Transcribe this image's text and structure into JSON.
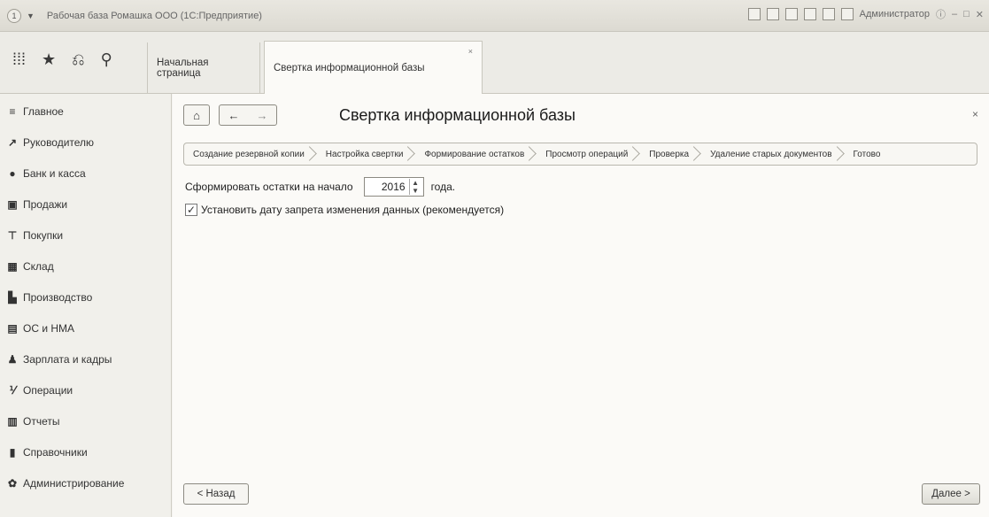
{
  "window": {
    "title": "Рабочая база Ромашка ООО  (1С:Предприятие)",
    "user": "Администратор"
  },
  "tabs": {
    "home_label": "Начальная страница",
    "active_label": "Свертка информационной базы",
    "close_glyph": "×"
  },
  "sidebar": {
    "items": [
      {
        "label": "Главное",
        "icon": "menu-icon",
        "glyph": "≡"
      },
      {
        "label": "Руководителю",
        "icon": "chart-line-icon",
        "glyph": "↗"
      },
      {
        "label": "Банк и касса",
        "icon": "coin-icon",
        "glyph": "●"
      },
      {
        "label": "Продажи",
        "icon": "bag-icon",
        "glyph": "▣"
      },
      {
        "label": "Покупки",
        "icon": "cart-icon",
        "glyph": "⊤"
      },
      {
        "label": "Склад",
        "icon": "warehouse-icon",
        "glyph": "▦"
      },
      {
        "label": "Производство",
        "icon": "factory-icon",
        "glyph": "▙"
      },
      {
        "label": "ОС и НМА",
        "icon": "assets-icon",
        "glyph": "▤"
      },
      {
        "label": "Зарплата и кадры",
        "icon": "person-icon",
        "glyph": "♟"
      },
      {
        "label": "Операции",
        "icon": "operations-icon",
        "glyph": "⅟"
      },
      {
        "label": "Отчеты",
        "icon": "reports-icon",
        "glyph": "▥"
      },
      {
        "label": "Справочники",
        "icon": "book-icon",
        "glyph": "▮"
      },
      {
        "label": "Администрирование",
        "icon": "gear-icon",
        "glyph": "✿"
      }
    ]
  },
  "main": {
    "title": "Свертка информационной базы",
    "close_glyph": "×",
    "steps": [
      "Создание резервной копии",
      "Настройка свертки",
      "Формирование остатков",
      "Просмотр операций",
      "Проверка",
      "Удаление старых документов",
      "Готово"
    ],
    "balance_label": "Сформировать остатки на начало",
    "year_value": "2016",
    "year_suffix": "года.",
    "checkbox_label": "Установить дату запрета изменения данных (рекомендуется)",
    "checkbox_checked": true,
    "back_label": "< Назад",
    "next_label": "Далее >"
  }
}
